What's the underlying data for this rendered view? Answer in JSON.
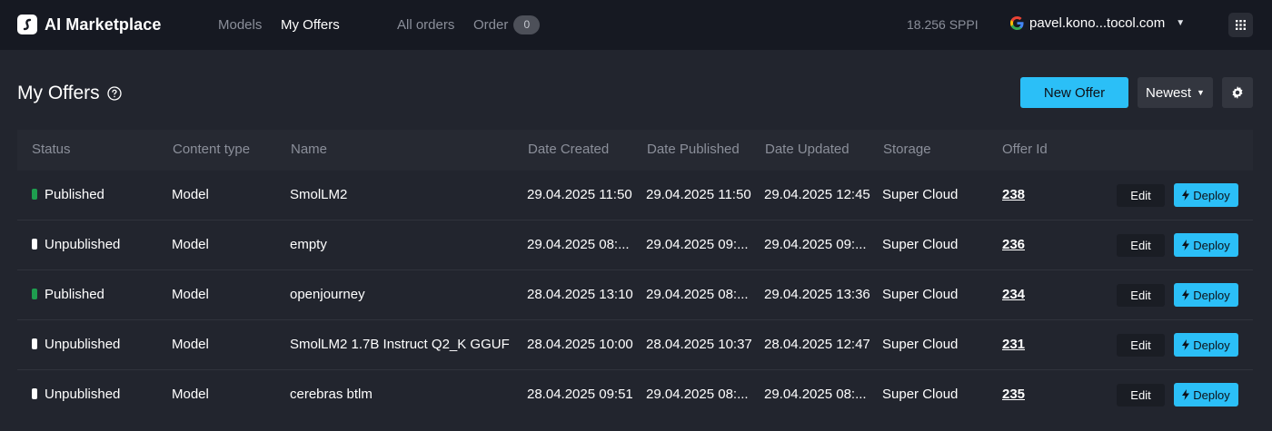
{
  "app": {
    "name": "AI Marketplace"
  },
  "nav": {
    "models": "Models",
    "my_offers": "My Offers",
    "all_orders": "All orders",
    "order": "Order",
    "order_count": "0"
  },
  "account": {
    "balance": "18.256 SPPI",
    "email": "pavel.kono...tocol.com"
  },
  "page": {
    "title": "My Offers",
    "new_offer_label": "New Offer",
    "sort_label": "Newest"
  },
  "colors": {
    "published": "#1e9e4f",
    "unpublished": "#ffffff",
    "accent": "#2bbff7"
  },
  "table": {
    "headers": {
      "status": "Status",
      "content_type": "Content type",
      "name": "Name",
      "date_created": "Date Created",
      "date_published": "Date Published",
      "date_updated": "Date Updated",
      "storage": "Storage",
      "offer_id": "Offer Id"
    },
    "edit_label": "Edit",
    "deploy_label": "Deploy",
    "rows": [
      {
        "status": "Published",
        "status_key": "published",
        "content_type": "Model",
        "name": "SmolLM2",
        "date_created": "29.04.2025 11:50",
        "date_published": "29.04.2025 11:50",
        "date_updated": "29.04.2025 12:45",
        "storage": "Super Cloud",
        "offer_id": "238"
      },
      {
        "status": "Unpublished",
        "status_key": "unpublished",
        "content_type": "Model",
        "name": "empty",
        "date_created": "29.04.2025 08:...",
        "date_published": "29.04.2025 09:...",
        "date_updated": "29.04.2025 09:...",
        "storage": "Super Cloud",
        "offer_id": "236"
      },
      {
        "status": "Published",
        "status_key": "published",
        "content_type": "Model",
        "name": "openjourney",
        "date_created": "28.04.2025 13:10",
        "date_published": "29.04.2025 08:...",
        "date_updated": "29.04.2025 13:36",
        "storage": "Super Cloud",
        "offer_id": "234"
      },
      {
        "status": "Unpublished",
        "status_key": "unpublished",
        "content_type": "Model",
        "name": "SmolLM2 1.7B Instruct Q2_K GGUF",
        "date_created": "28.04.2025 10:00",
        "date_published": "28.04.2025 10:37",
        "date_updated": "28.04.2025 12:47",
        "storage": "Super Cloud",
        "offer_id": "231"
      },
      {
        "status": "Unpublished",
        "status_key": "unpublished",
        "content_type": "Model",
        "name": "cerebras btlm",
        "date_created": "28.04.2025 09:51",
        "date_published": "29.04.2025 08:...",
        "date_updated": "29.04.2025 08:...",
        "storage": "Super Cloud",
        "offer_id": "235"
      }
    ]
  }
}
